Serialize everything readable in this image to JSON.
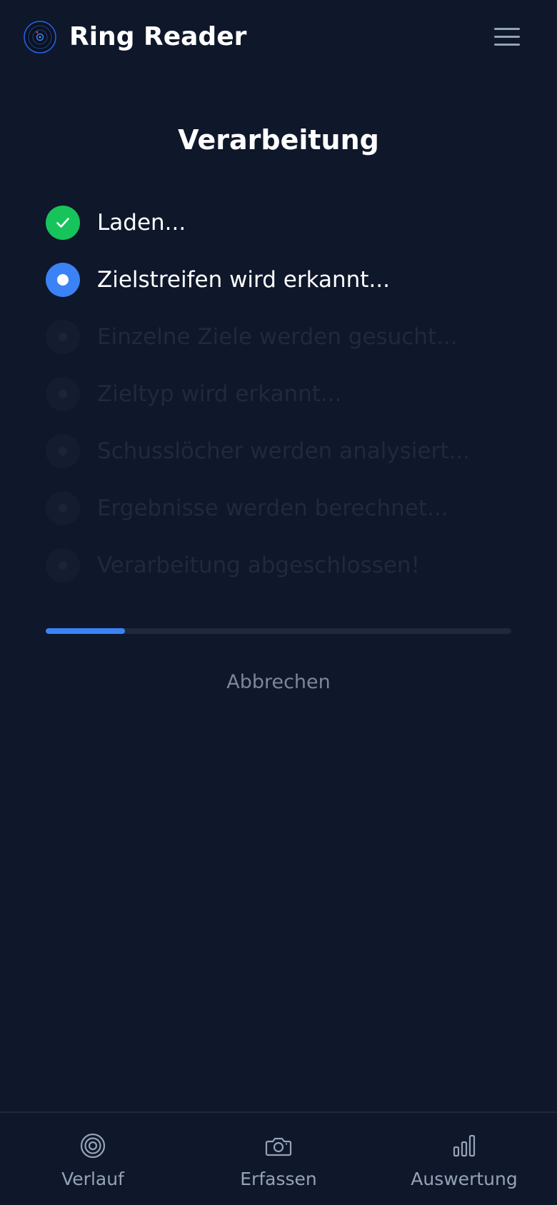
{
  "header": {
    "app_title": "Ring Reader",
    "logo_icon": "target-logo-icon",
    "menu_icon": "hamburger-menu-icon"
  },
  "page": {
    "title": "Verarbeitung"
  },
  "steps": [
    {
      "label": "Laden...",
      "status": "done"
    },
    {
      "label": "Zielstreifen wird erkannt...",
      "status": "active"
    },
    {
      "label": "Einzelne Ziele werden gesucht...",
      "status": "pending"
    },
    {
      "label": "Zieltyp wird erkannt...",
      "status": "pending"
    },
    {
      "label": "Schusslöcher werden analysiert...",
      "status": "pending"
    },
    {
      "label": "Ergebnisse werden berechnet...",
      "status": "pending"
    },
    {
      "label": "Verarbeitung abgeschlossen!",
      "status": "pending"
    }
  ],
  "progress": {
    "fraction": 0.17
  },
  "actions": {
    "cancel_label": "Abbrechen"
  },
  "bottom_nav": {
    "items": [
      {
        "label": "Verlauf",
        "icon": "target-icon"
      },
      {
        "label": "Erfassen",
        "icon": "camera-icon"
      },
      {
        "label": "Auswertung",
        "icon": "bar-chart-icon"
      }
    ]
  },
  "colors": {
    "background": "#0f172a",
    "accent": "#3b82f6",
    "success": "#17c45b",
    "muted_text": "#94a3b8"
  }
}
